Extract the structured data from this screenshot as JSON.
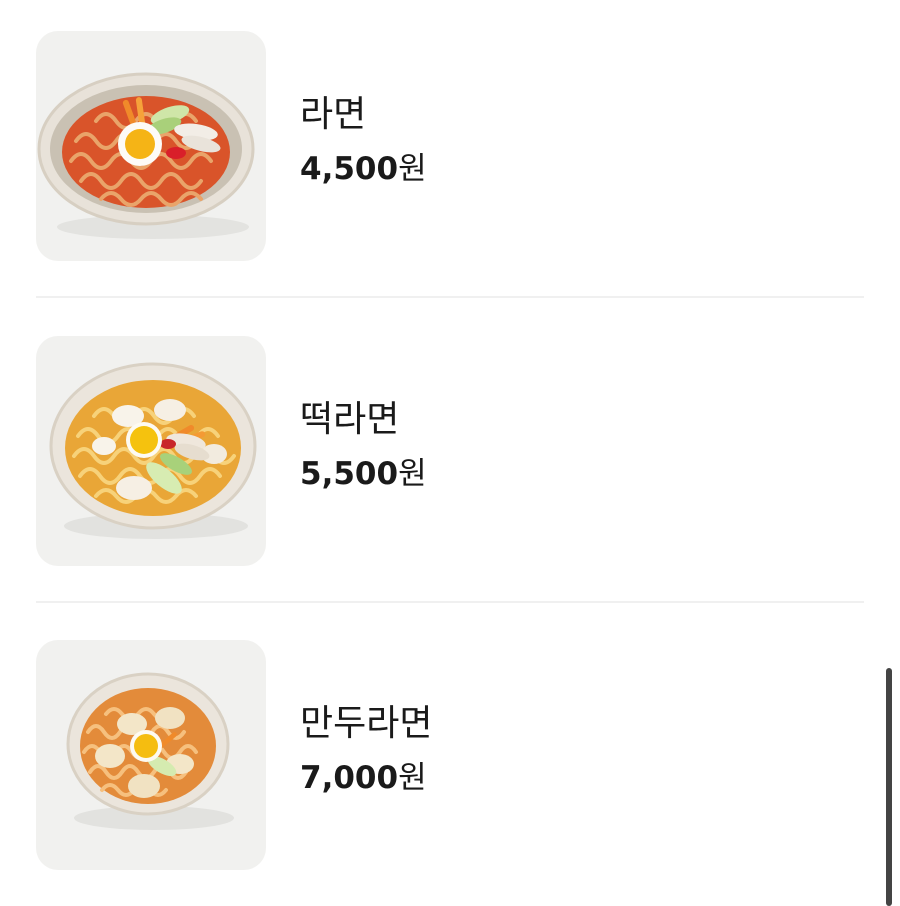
{
  "menu": {
    "items": [
      {
        "name": "라면",
        "price_number": "4,500",
        "price_unit": "원",
        "image": "ramen-bowl-photo"
      },
      {
        "name": "떡라면",
        "price_number": "5,500",
        "price_unit": "원",
        "image": "tteok-ramen-bowl-photo"
      },
      {
        "name": "만두라면",
        "price_number": "7,000",
        "price_unit": "원",
        "image": "mandu-ramen-bowl-photo"
      }
    ]
  },
  "colors": {
    "text": "#1a1a1a",
    "thumb_background": "#f1f1ef",
    "divider": "#f0f0f0",
    "scrollbar": "#444444"
  }
}
